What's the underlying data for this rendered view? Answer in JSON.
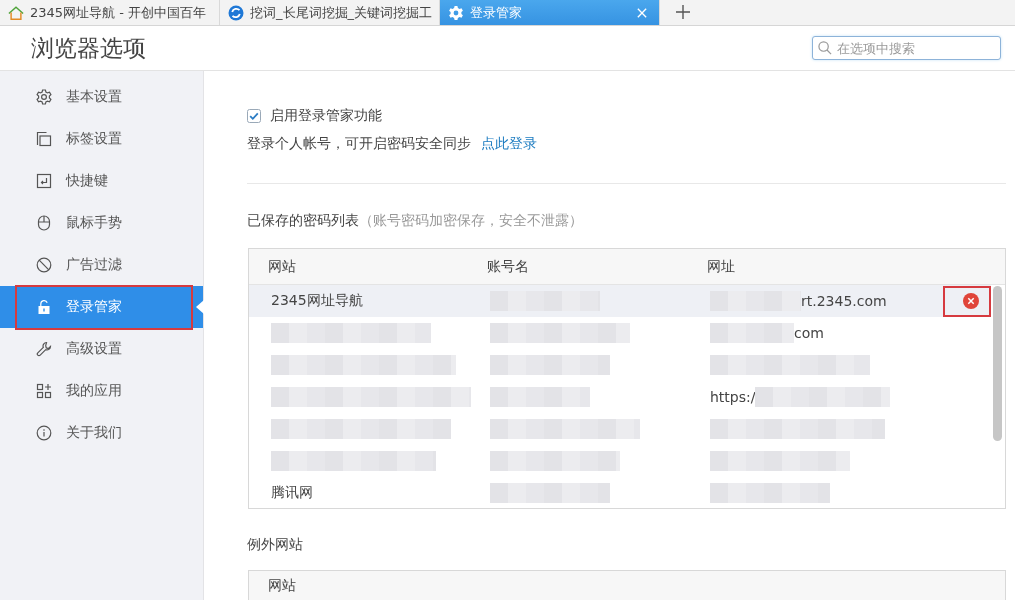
{
  "tabs": [
    {
      "title": "2345网址导航 - 开创中国百年",
      "selected": false
    },
    {
      "title": "挖词_长尾词挖掘_关键词挖掘工",
      "selected": false
    },
    {
      "title": "登录管家",
      "selected": true
    }
  ],
  "header": {
    "title": "浏览器选项",
    "search": {
      "placeholder": "在选项中搜索"
    }
  },
  "sidebar": {
    "items": [
      {
        "label": "基本设置",
        "selected": false,
        "highlighted": false
      },
      {
        "label": "标签设置",
        "selected": false,
        "highlighted": false
      },
      {
        "label": "快捷键",
        "selected": false,
        "highlighted": false
      },
      {
        "label": "鼠标手势",
        "selected": false,
        "highlighted": false
      },
      {
        "label": "广告过滤",
        "selected": false,
        "highlighted": false
      },
      {
        "label": "登录管家",
        "selected": true,
        "highlighted": true
      },
      {
        "label": "高级设置",
        "selected": false,
        "highlighted": false
      },
      {
        "label": "我的应用",
        "selected": false,
        "highlighted": false
      },
      {
        "label": "关于我们",
        "selected": false,
        "highlighted": false
      }
    ]
  },
  "login_manager": {
    "enable": {
      "label": "启用登录管家功能",
      "checked": true
    },
    "sync_text": "登录个人帐号，可开启密码安全同步",
    "sync_link": "点此登录"
  },
  "saved_passwords": {
    "title": "已保存的密码列表",
    "note": "（账号密码加密保存，安全不泄露）",
    "table": {
      "columns": [
        "网站",
        "账号名",
        "网址"
      ],
      "rows": [
        {
          "selected": true,
          "delete_highlighted": true,
          "cells": [
            {
              "kind": "plain",
              "text": "2345网址导航"
            },
            {
              "kind": "blurred"
            },
            {
              "kind": "tail",
              "text": "rt.2345.com"
            }
          ]
        },
        {
          "selected": false,
          "delete_highlighted": false,
          "cells": [
            {
              "kind": "blurred"
            },
            {
              "kind": "blurred"
            },
            {
              "kind": "tail",
              "text": "com"
            }
          ]
        },
        {
          "selected": false,
          "delete_highlighted": false,
          "cells": [
            {
              "kind": "blurred"
            },
            {
              "kind": "blurred"
            },
            {
              "kind": "blurred"
            }
          ]
        },
        {
          "selected": false,
          "delete_highlighted": false,
          "cells": [
            {
              "kind": "blurred"
            },
            {
              "kind": "blurred"
            },
            {
              "kind": "head",
              "text": "https:/"
            }
          ]
        },
        {
          "selected": false,
          "delete_highlighted": false,
          "cells": [
            {
              "kind": "blurred"
            },
            {
              "kind": "blurred"
            },
            {
              "kind": "blurred"
            }
          ]
        },
        {
          "selected": false,
          "delete_highlighted": false,
          "cells": [
            {
              "kind": "blurred"
            },
            {
              "kind": "blurred"
            },
            {
              "kind": "blurred"
            }
          ]
        },
        {
          "selected": false,
          "delete_highlighted": false,
          "cells": [
            {
              "kind": "plain",
              "text": "腾讯网"
            },
            {
              "kind": "blurred"
            },
            {
              "kind": "blurred"
            }
          ]
        }
      ]
    }
  },
  "exceptions": {
    "title": "例外网站",
    "table": {
      "columns": [
        "网站"
      ]
    }
  }
}
